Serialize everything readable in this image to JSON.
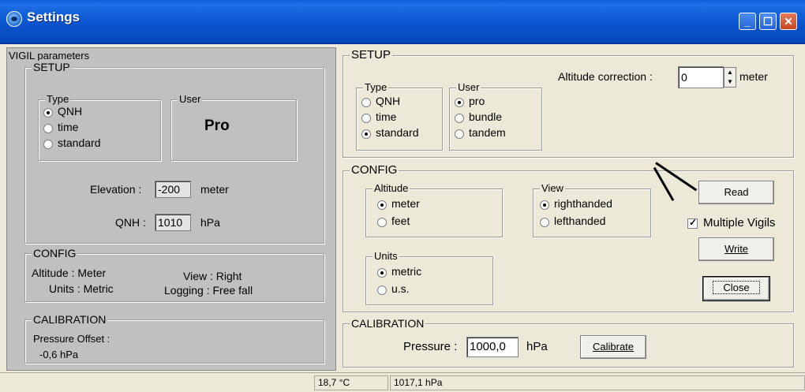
{
  "window": {
    "title": "Settings"
  },
  "vigil": {
    "header": "VIGIL parameters",
    "setup": {
      "legend": "SETUP",
      "type_legend": "Type",
      "type_options": [
        "QNH",
        "time",
        "standard"
      ],
      "type_selected": 0,
      "user_legend": "User",
      "user_value": "Pro",
      "elevation_label": "Elevation :",
      "elevation_value": "-200",
      "elevation_unit": "meter",
      "qnh_label": "QNH :",
      "qnh_value": "1010",
      "qnh_unit": "hPa"
    },
    "config": {
      "legend": "CONFIG",
      "altitude": "Altitude : Meter",
      "units": "Units : Metric",
      "view": "View : Right",
      "logging": "Logging : Free fall"
    },
    "calibration": {
      "legend": "CALIBRATION",
      "offset_label": "Pressure Offset :",
      "offset_value": "-0,6  hPa"
    }
  },
  "setup": {
    "legend": "SETUP",
    "altitude_correction_label": "Altitude correction :",
    "altitude_correction_value": "0",
    "altitude_correction_unit": "meter",
    "type_legend": "Type",
    "type_options": [
      "QNH",
      "time",
      "standard"
    ],
    "type_selected": 2,
    "user_legend": "User",
    "user_options": [
      "pro",
      "bundle",
      "tandem"
    ],
    "user_selected": 0
  },
  "config": {
    "legend": "CONFIG",
    "altitude_legend": "Altitude",
    "altitude_options": [
      "meter",
      "feet"
    ],
    "altitude_selected": 0,
    "view_legend": "View",
    "view_options": [
      "righthanded",
      "lefthanded"
    ],
    "view_selected": 0,
    "units_legend": "Units",
    "units_options": [
      "metric",
      "u.s."
    ],
    "units_selected": 0,
    "read_label": "Read",
    "multiple_vigils_label": "Multiple Vigils",
    "multiple_vigils_checked": true,
    "write_label": "Write",
    "close_label": "Close"
  },
  "calibration": {
    "legend": "CALIBRATION",
    "pressure_label": "Pressure :",
    "pressure_value": "1000,0",
    "pressure_unit": "hPa",
    "calibrate_label": "Calibrate"
  },
  "status": {
    "temperature": "18,7 °C",
    "pressure": "1017,1 hPa"
  }
}
